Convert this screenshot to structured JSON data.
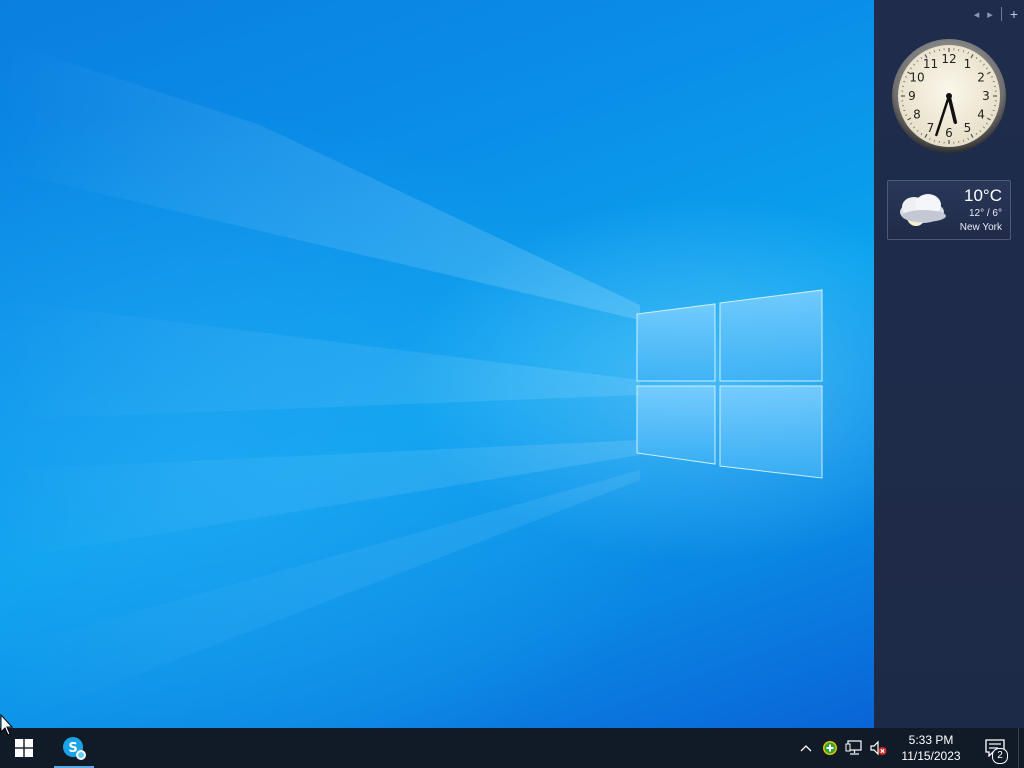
{
  "sidebar": {
    "controls": {
      "prev": "◂",
      "next": "▸",
      "add": "+"
    },
    "clock": {
      "numbers": [
        "12",
        "1",
        "2",
        "3",
        "4",
        "5",
        "6",
        "7",
        "8",
        "9",
        "10",
        "11"
      ],
      "hour": 5,
      "minute": 33
    },
    "weather": {
      "temperature": "10°C",
      "range": "12° / 6°",
      "city": "New York",
      "icon": "cloudy-night-icon"
    }
  },
  "taskbar": {
    "start_icon": "windows-logo-icon",
    "pinned": [
      {
        "name": "Skype",
        "icon": "skype-icon",
        "active": true
      }
    ],
    "tray": {
      "chevron": "^",
      "time": "5:33 PM",
      "date": "11/15/2023",
      "notifications_count": "2"
    }
  },
  "colors": {
    "taskbar_bg": "#101b27",
    "sidebar_bg": "#1f2c4c",
    "accent": "#0a8fe8"
  }
}
